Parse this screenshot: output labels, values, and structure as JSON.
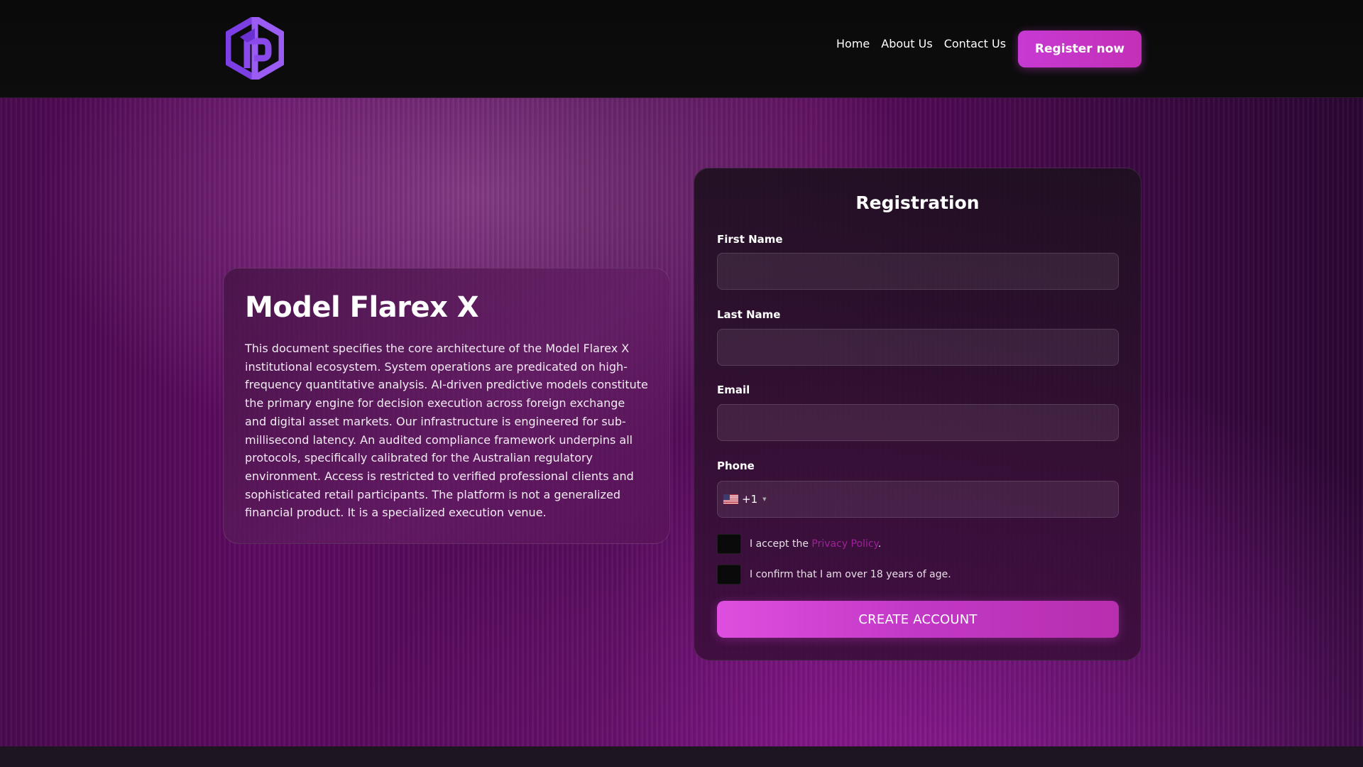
{
  "colors": {
    "accent": "#c63ad3",
    "logo_purple": "#7b3fe4",
    "link": "#a0219b",
    "background_dark": "#0a0a0a"
  },
  "header": {
    "logo_icon": "hexagon-p-logo-icon",
    "nav": [
      {
        "label": "Home"
      },
      {
        "label": "About Us"
      },
      {
        "label": "Contact Us"
      }
    ],
    "register_label": "Register now"
  },
  "info": {
    "title": "Model Flarex X",
    "text": "This document specifies the core architecture of the Model Flarex X institutional ecosystem. System operations are predicated on high-frequency quantitative analysis. AI-driven predictive models constitute the primary engine for decision execution across foreign exchange and digital asset markets. Our infrastructure is engineered for sub-millisecond latency. An audited compliance framework underpins all protocols, specifically calibrated for the Australian regulatory environment. Access is restricted to verified professional clients and sophisticated retail participants. The platform is not a generalized financial product. It is a specialized execution venue."
  },
  "form": {
    "title": "Registration",
    "first_name_label": "First Name",
    "first_name_value": "",
    "last_name_label": "Last Name",
    "last_name_value": "",
    "email_label": "Email",
    "email_value": "",
    "phone_label": "Phone",
    "phone_country_icon": "us-flag-icon",
    "phone_dial_code": "+1",
    "phone_value": "",
    "privacy_prefix": "I accept the ",
    "privacy_link": "Privacy Policy",
    "privacy_suffix": ".",
    "age_confirm": "I confirm that I am over 18 years of age.",
    "submit_label": "CREATE ACCOUNT"
  }
}
